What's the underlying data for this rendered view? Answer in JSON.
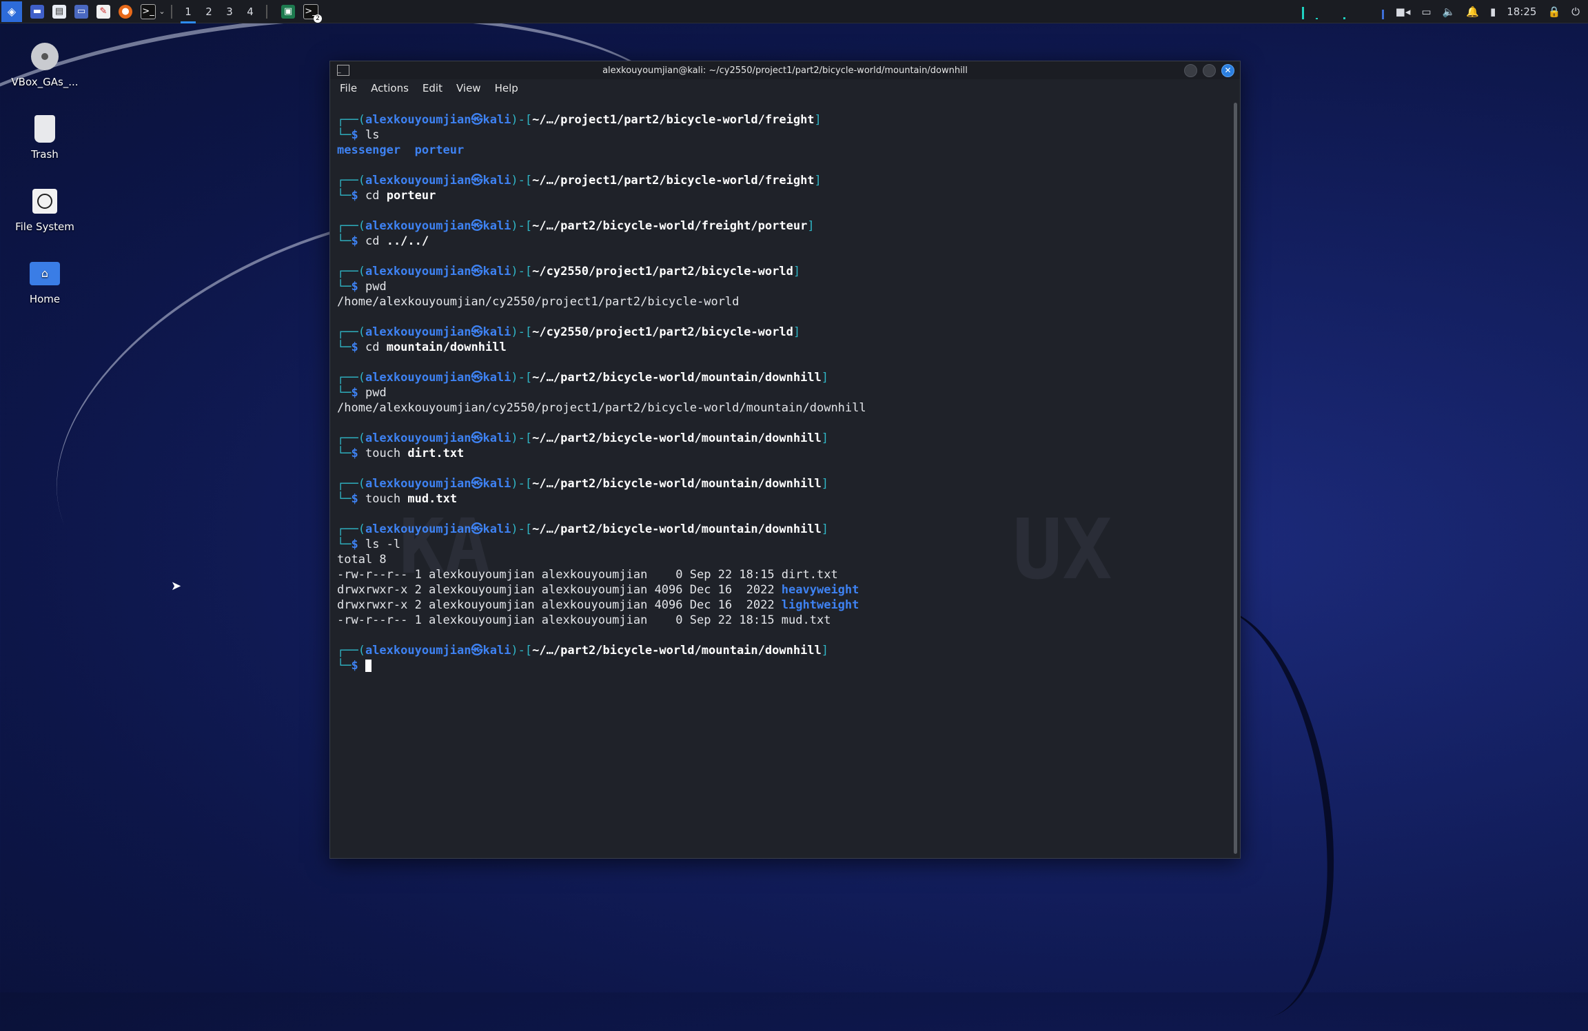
{
  "taskbar": {
    "workspaces": [
      "1",
      "2",
      "3",
      "4"
    ],
    "active_workspace": "1",
    "terminal_badge": "2",
    "clock": "18:25",
    "icons": [
      "kali-menu-icon",
      "desktop-icon",
      "file-manager-icon",
      "text-editor-icon",
      "document-icon",
      "firefox-icon",
      "terminal-icon"
    ],
    "colors": {
      "panel": "#1a1c22",
      "accent": "#2d8cf0",
      "graph": "#1fd1c1"
    }
  },
  "desktop": {
    "icons": [
      {
        "label": "VBox_GAs_...",
        "icon": "disc-icon"
      },
      {
        "label": "Trash",
        "icon": "trash-icon"
      },
      {
        "label": "File System",
        "icon": "drive-icon"
      },
      {
        "label": "Home",
        "icon": "home-folder-icon"
      }
    ]
  },
  "window": {
    "title": "alexkouyoumjian@kali: ~/cy2550/project1/part2/bicycle-world/mountain/downhill",
    "menu": [
      "File",
      "Actions",
      "Edit",
      "View",
      "Help"
    ]
  },
  "terminal": {
    "user": "alexkouyoumjian",
    "host": "kali",
    "blocks": [
      {
        "path": "~/…/project1/part2/bicycle-world/freight",
        "cmd": "ls",
        "arg": "",
        "output": []
      },
      {
        "path": "~/…/project1/part2/bicycle-world/freight",
        "cmd": "cd",
        "arg": "porteur",
        "output": []
      },
      {
        "path": "~/…/part2/bicycle-world/freight/porteur",
        "cmd": "cd",
        "arg": "../../",
        "output": []
      },
      {
        "path": "~/cy2550/project1/part2/bicycle-world",
        "cmd": "pwd",
        "arg": "",
        "output": [
          "/home/alexkouyoumjian/cy2550/project1/part2/bicycle-world"
        ]
      },
      {
        "path": "~/cy2550/project1/part2/bicycle-world",
        "cmd": "cd",
        "arg": "mountain/downhill",
        "output": []
      },
      {
        "path": "~/…/part2/bicycle-world/mountain/downhill",
        "cmd": "pwd",
        "arg": "",
        "output": [
          "/home/alexkouyoumjian/cy2550/project1/part2/bicycle-world/mountain/downhill"
        ]
      },
      {
        "path": "~/…/part2/bicycle-world/mountain/downhill",
        "cmd": "touch",
        "arg": "dirt.txt",
        "output": []
      },
      {
        "path": "~/…/part2/bicycle-world/mountain/downhill",
        "cmd": "touch",
        "arg": "mud.txt",
        "output": []
      },
      {
        "path": "~/…/part2/bicycle-world/mountain/downhill",
        "cmd": "ls -l",
        "arg": "",
        "output": [
          "total 8"
        ]
      },
      {
        "path": "~/…/part2/bicycle-world/mountain/downhill",
        "cmd": "",
        "arg": "",
        "output": []
      }
    ],
    "ls_output": {
      "dir1": "messenger",
      "dir2": "porteur"
    },
    "ls_long": [
      {
        "meta": "-rw-r--r-- 1 alexkouyoumjian alexkouyoumjian    0 Sep 22 18:15 ",
        "name": "dirt.txt",
        "dir": false
      },
      {
        "meta": "drwxrwxr-x 2 alexkouyoumjian alexkouyoumjian 4096 Dec 16  2022 ",
        "name": "heavyweight",
        "dir": true
      },
      {
        "meta": "drwxrwxr-x 2 alexkouyoumjian alexkouyoumjian 4096 Dec 16  2022 ",
        "name": "lightweight",
        "dir": true
      },
      {
        "meta": "-rw-r--r-- 1 alexkouyoumjian alexkouyoumjian    0 Sep 22 18:15 ",
        "name": "mud.txt",
        "dir": false
      }
    ],
    "colors": {
      "prompt_frame": "#2fb6c6",
      "user": "#3e82f2",
      "dir": "#3e82f2",
      "bg": "#1f2229"
    }
  }
}
